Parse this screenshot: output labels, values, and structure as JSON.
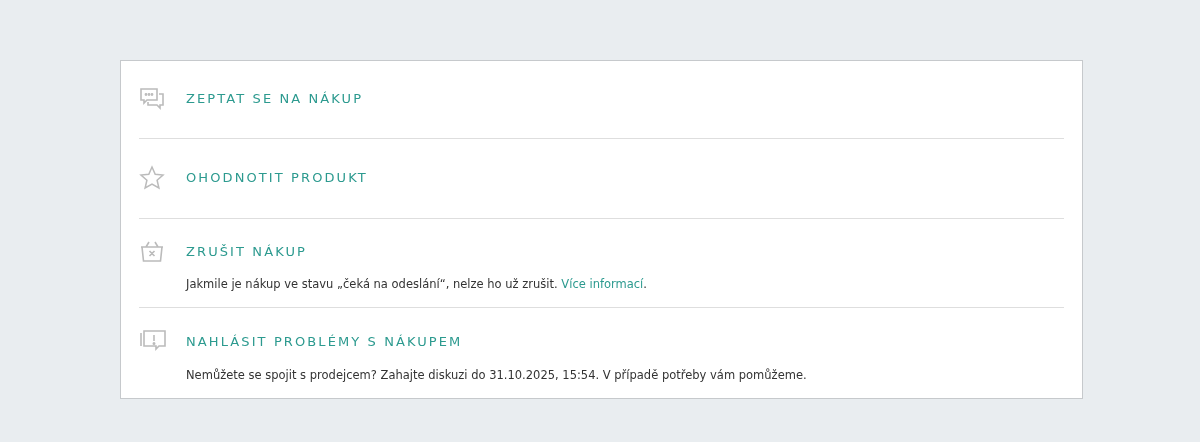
{
  "actions": [
    {
      "kind": "chat",
      "title": "ZEPTAT SE NA NÁKUP"
    },
    {
      "kind": "star",
      "title": "OHODNOTIT PRODUKT"
    },
    {
      "kind": "cancel",
      "title": "ZRUŠIT NÁKUP",
      "description": "Jakmile je nákup ve stavu „čeká na odeslání“, nelze ho už zrušit.",
      "link": "Více informací",
      "after_link": "."
    },
    {
      "kind": "report",
      "title": "NAHLÁSIT PROBLÉMY S NÁKUPEM",
      "description": "Nemůžete se spojit s prodejcem? Zahajte diskuzi do 31.10.2025, 15:54. V případě potřeby vám pomůžeme."
    }
  ]
}
